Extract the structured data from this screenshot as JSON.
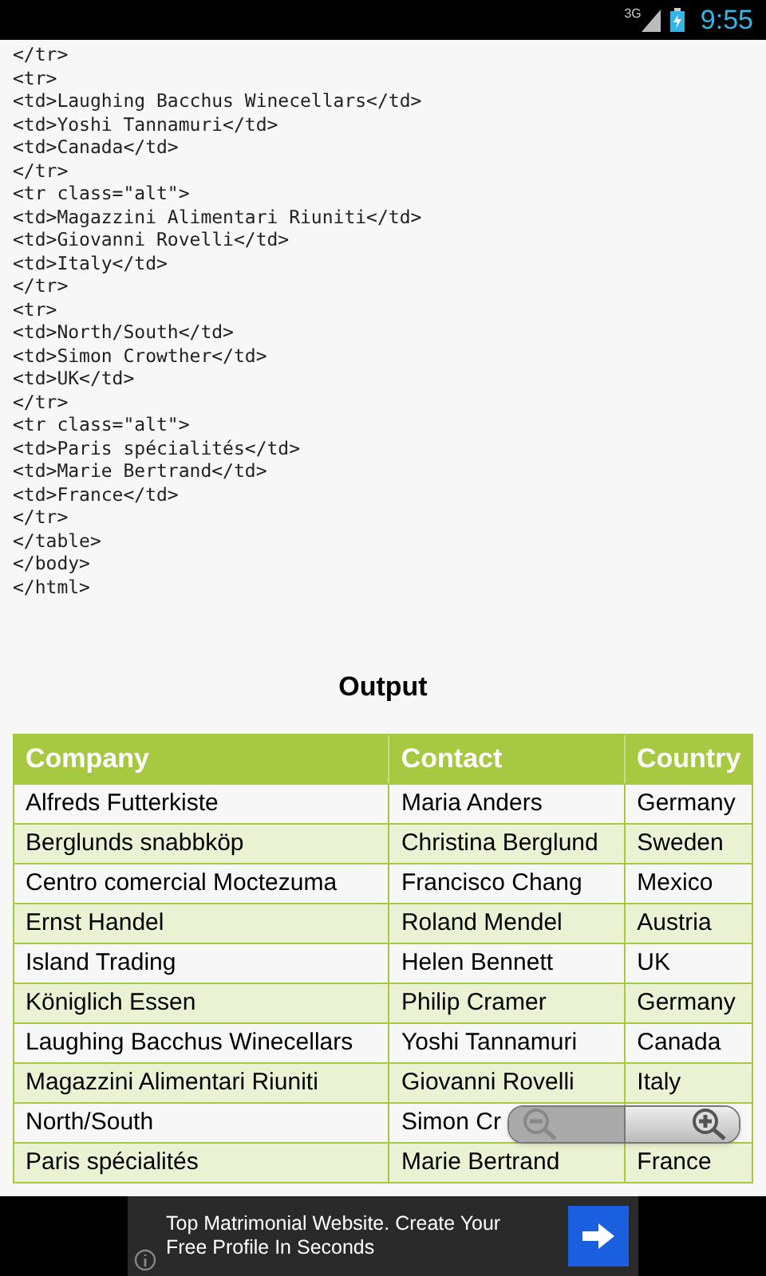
{
  "status_bar": {
    "network": "3G",
    "time": "9:55"
  },
  "code_lines": [
    "</tr>",
    "<tr>",
    "<td>Laughing Bacchus Winecellars</td>",
    "<td>Yoshi Tannamuri</td>",
    "<td>Canada</td>",
    "</tr>",
    "<tr class=\"alt\">",
    "<td>Magazzini Alimentari Riuniti</td>",
    "<td>Giovanni Rovelli</td>",
    "<td>Italy</td>",
    "</tr>",
    "<tr>",
    "<td>North/South</td>",
    "<td>Simon Crowther</td>",
    "<td>UK</td>",
    "</tr>",
    "<tr class=\"alt\">",
    "<td>Paris spécialités</td>",
    "<td>Marie Bertrand</td>",
    "<td>France</td>",
    "</tr>",
    "</table>",
    "</body>",
    "</html>"
  ],
  "output_heading": "Output",
  "table": {
    "columns": [
      "Company",
      "Contact",
      "Country"
    ],
    "rows": [
      {
        "alt": false,
        "cells": [
          "Alfreds Futterkiste",
          "Maria Anders",
          "Germany"
        ]
      },
      {
        "alt": true,
        "cells": [
          "Berglunds snabbköp",
          "Christina Berglund",
          "Sweden"
        ]
      },
      {
        "alt": false,
        "cells": [
          "Centro comercial Moctezuma",
          "Francisco Chang",
          "Mexico"
        ]
      },
      {
        "alt": true,
        "cells": [
          "Ernst Handel",
          "Roland Mendel",
          "Austria"
        ]
      },
      {
        "alt": false,
        "cells": [
          "Island Trading",
          "Helen Bennett",
          "UK"
        ]
      },
      {
        "alt": true,
        "cells": [
          "Königlich Essen",
          "Philip Cramer",
          "Germany"
        ]
      },
      {
        "alt": false,
        "cells": [
          "Laughing Bacchus Winecellars",
          "Yoshi Tannamuri",
          "Canada"
        ]
      },
      {
        "alt": true,
        "cells": [
          "Magazzini Alimentari Riuniti",
          "Giovanni Rovelli",
          "Italy"
        ]
      },
      {
        "alt": false,
        "cells": [
          "North/South",
          "Simon Cr"
        ]
      },
      {
        "alt": true,
        "cells": [
          "Paris spécialités",
          "Marie Bertrand",
          "France"
        ]
      }
    ]
  },
  "ad": {
    "text": "Top Matrimonial Website. Create Your Free Profile In Seconds"
  }
}
